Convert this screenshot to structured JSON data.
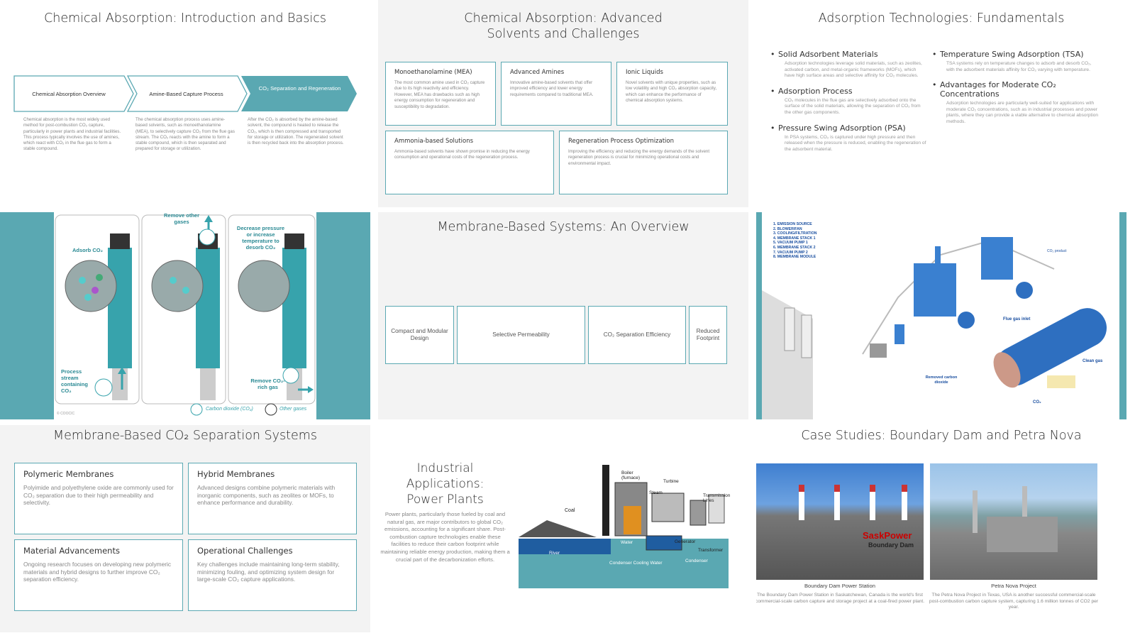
{
  "s1": {
    "title": "Chemical Absorption: Introduction and Basics",
    "steps": [
      "Chemical Absorption Overview",
      "Amine-Based Capture Process",
      "CO₂ Separation and Regeneration"
    ],
    "texts": [
      "Chemical absorption is the most widely used method for post-combustion CO₂ capture, particularly in power plants and industrial facilities. This process typically involves the use of amines, which react with CO₂ in the flue gas to form a stable compound.",
      "The chemical absorption process uses amine-based solvents, such as monoethanolamine (MEA), to selectively capture CO₂ from the flue gas stream. The CO₂ reacts with the amine to form a stable compound, which is then separated and prepared for storage or utilization.",
      "After the CO₂ is absorbed by the amine-based solvent, the compound is heated to release the CO₂, which is then compressed and transported for storage or utilization. The regenerated solvent is then recycled back into the absorption process."
    ]
  },
  "s2": {
    "title": "Chemical Absorption: Advanced Solvents and Challenges",
    "boxes": [
      {
        "h": "Monoethanolamine (MEA)",
        "p": "The most common amine used in CO₂ capture due to its high reactivity and efficiency. However, MEA has drawbacks such as high energy consumption for regeneration and susceptibility to degradation."
      },
      {
        "h": "Advanced Amines",
        "p": "Innovative amine-based solvents that offer improved efficiency and lower energy requirements compared to traditional MEA."
      },
      {
        "h": "Ionic Liquids",
        "p": "Novel solvents with unique properties, such as low volatility and high CO₂ absorption capacity, which can enhance the performance of chemical absorption systems."
      },
      {
        "h": "Ammonia-based Solutions",
        "p": "Ammonia-based solvents have shown promise in reducing the energy consumption and operational costs of the regeneration process."
      },
      {
        "h": "Regeneration Process Optimization",
        "p": "Improving the efficiency and reducing the energy demands of the solvent regeneration process is crucial for minimizing operational costs and environmental impact."
      }
    ]
  },
  "s3": {
    "title": "Adsorption Technologies: Fundamentals",
    "left": [
      {
        "h": "Solid Adsorbent Materials",
        "p": "Adsorption technologies leverage solid materials, such as zeolites, activated carbon, and metal-organic frameworks (MOFs), which have high surface areas and selective affinity for CO₂ molecules."
      },
      {
        "h": "Adsorption Process",
        "p": "CO₂ molecules in the flue gas are selectively adsorbed onto the surface of the solid materials, allowing the separation of CO₂ from the other gas components."
      },
      {
        "h": "Pressure Swing Adsorption (PSA)",
        "p": "In PSA systems, CO₂ is captured under high pressure and then released when the pressure is reduced, enabling the regeneration of the adsorbent material."
      }
    ],
    "right": [
      {
        "h": "Temperature Swing Adsorption (TSA)",
        "p": "TSA systems rely on temperature changes to adsorb and desorb CO₂, with the adsorbent materials affinity for CO₂ varying with temperature."
      },
      {
        "h": "Advantages for Moderate CO₂ Concentrations",
        "p": "Adsorption technologies are particularly well-suited for applications with moderate CO₂ concentrations, such as in industrial processes and power plants, where they can provide a viable alternative to chemical absorption methods."
      }
    ]
  },
  "s4": {
    "labels": {
      "adsorb": "Adsorb CO₂",
      "remove_other": "Remove other gases",
      "decrease": "Decrease pressure or increase temperature to desorb CO₂",
      "process": "Process stream containing CO₂",
      "remove_rich": "Remove CO₂-rich gas",
      "legend_co2": "Carbon dioxide (CO₂)",
      "legend_other": "Other gases",
      "credit": "© COOCIC"
    }
  },
  "s5": {
    "title": "Membrane-Based Systems: An Overview",
    "cells": [
      "Compact and Modular Design",
      "Selective Permeability",
      "CO₂ Separation Efficiency",
      "Reduced Footprint"
    ]
  },
  "s6": {
    "legend": [
      "1. EMISSION SOURCE",
      "2. BLOWER/FAN",
      "3. COOLING/FILTRATION",
      "4. MEMBRANE STACK 1",
      "5. VACUUM PUMP 1",
      "6. MEMBRANE STACK 2",
      "7. VACUUM PUMP 2",
      "8. MEMBRANE MODULE"
    ],
    "flue_gas_inlet": "Flue gas inlet",
    "clean_gas": "Clean gas",
    "removed_co2": "Removed carbon dioxide",
    "co2": "CO₂",
    "co2_product": "CO₂ product"
  },
  "s7": {
    "title": "Membrane-Based CO₂ Separation Systems",
    "boxes": [
      {
        "h": "Polymeric Membranes",
        "p": "Polyimide and polyethylene oxide are commonly used for CO₂ separation due to their high permeability and selectivity."
      },
      {
        "h": "Hybrid Membranes",
        "p": "Advanced designs combine polymeric materials with inorganic components, such as zeolites or MOFs, to enhance performance and durability."
      },
      {
        "h": "Material Advancements",
        "p": "Ongoing research focuses on developing new polymeric materials and hybrid designs to further improve CO₂ separation efficiency."
      },
      {
        "h": "Operational Challenges",
        "p": "Key challenges include maintaining long-term stability, minimizing fouling, and optimizing system design for large-scale CO₂ capture applications."
      }
    ]
  },
  "s8": {
    "title": "Industrial Applications: Power Plants",
    "text": "Power plants, particularly those fueled by coal and natural gas, are major contributors to global CO₂ emissions, accounting for a significant share. Post-combustion capture technologies enable these facilities to reduce their carbon footprint while maintaining reliable energy production, making them a crucial part of the decarbonization efforts.",
    "diagram": {
      "coal": "Coal",
      "boiler": "Boiler (furnace)",
      "steam": "Steam",
      "turbine": "Turbine",
      "transmission": "Transmission Lines",
      "water": "Water",
      "generator": "Generator",
      "transformer": "Transformer",
      "river": "River",
      "condenser_cooling": "Condenser Cooling Water",
      "condenser": "Condenser"
    }
  },
  "s9": {
    "title": "Case Studies: Boundary Dam and Petra Nova",
    "cases": [
      {
        "caption": "Boundary Dam Power Station",
        "desc": "The Boundary Dam Power Station in Saskatchewan, Canada is the world's first commercial-scale carbon capture and storage project at a coal-fired power plant.",
        "sign1": "SaskPower",
        "sign2": "Boundary Dam"
      },
      {
        "caption": "Petra Nova Project",
        "desc": "The Petra Nova Project in Texas, USA is another successful commercial-scale post-combustion carbon capture system, capturing 1.6 million tonnes of CO2 per year."
      }
    ]
  }
}
